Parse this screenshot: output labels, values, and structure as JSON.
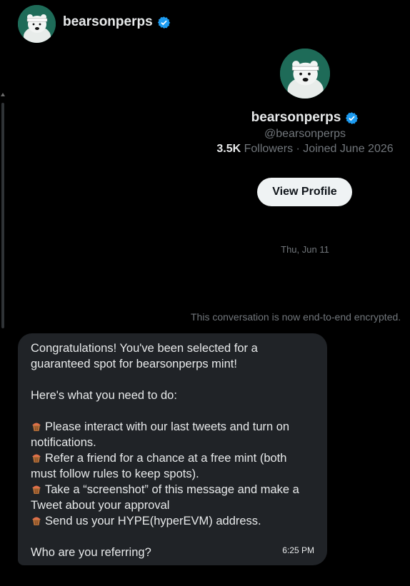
{
  "header": {
    "name": "bearsonperps"
  },
  "profile": {
    "name": "bearsonperps",
    "handle": "@bearsonperps",
    "followers_count": "3.5K",
    "followers_label": "Followers",
    "joined": "· Joined June 2026",
    "view_profile_label": "View Profile"
  },
  "conversation": {
    "date": "Thu, Jun 11",
    "encryption_notice": "This conversation is now end-to-end encrypted."
  },
  "message": {
    "line1": "Congratulations! You've been selected for a guaranteed spot for bearsonperps mint!",
    "line2": "Here's what you need to do:",
    "bullets": [
      "Please interact with our last tweets and turn on notifications.",
      "Refer a friend for a chance at a free mint (both must follow rules to keep spots).",
      "Take a “screenshot” of this message and make a Tweet about your approval",
      "Send us your HYPE(hyperEVM) address."
    ],
    "closing": "Who are you referring?",
    "time": "6:25 PM"
  },
  "colors": {
    "accent": "#1d9bf0",
    "avatar_bg": "#1e6b58",
    "bubble_bg": "#202327"
  },
  "icons": {
    "verified": "verified-badge-icon",
    "bullet": "cupcake-emoji-icon"
  }
}
